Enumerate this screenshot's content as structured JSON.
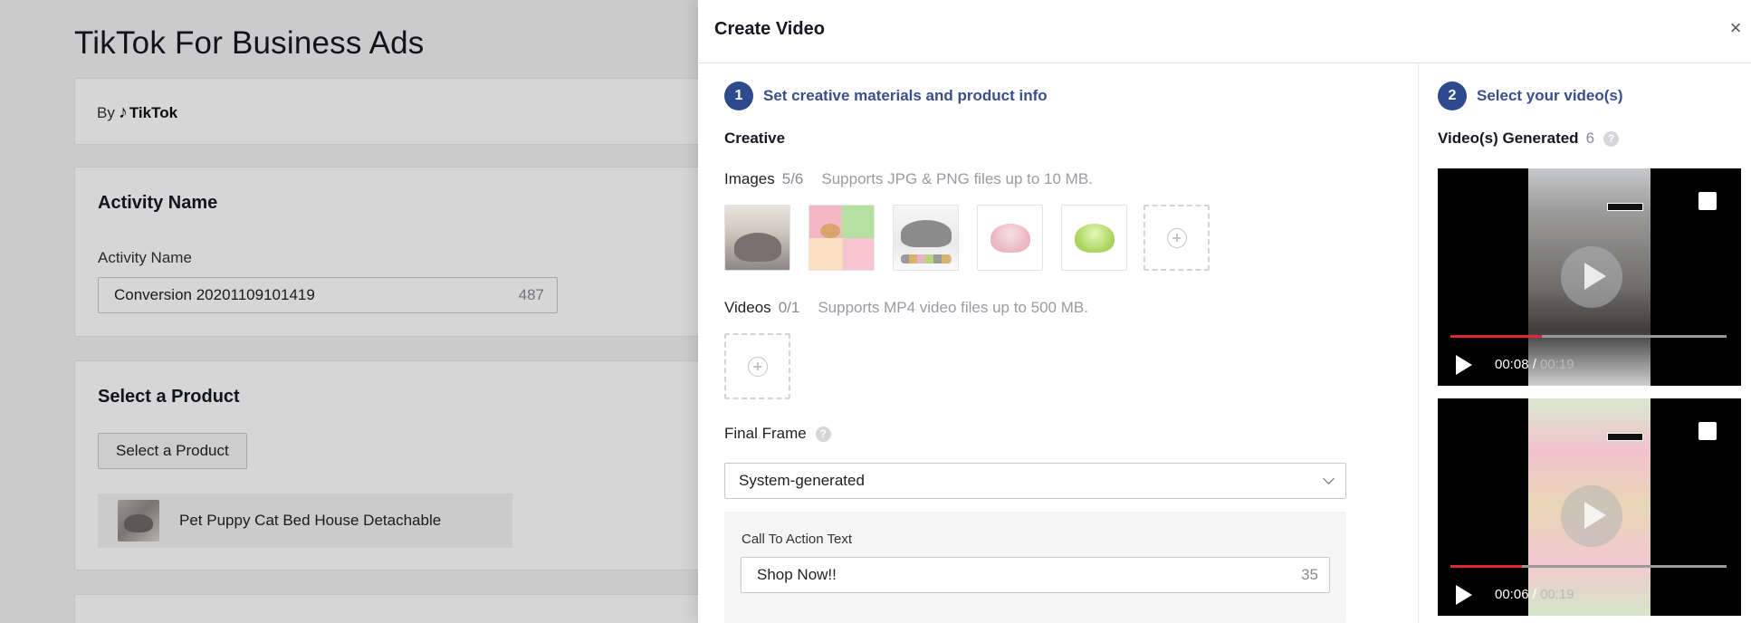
{
  "background_page": {
    "title": "TikTok For Business Ads",
    "by_label": "By",
    "tiktok_brand": "TikTok",
    "activity_card": {
      "heading": "Activity Name",
      "field_label": "Activity Name",
      "value": "Conversion 20201109101419",
      "char_count": "487"
    },
    "product_card": {
      "heading": "Select a Product",
      "button_label": "Select a Product",
      "selected_product": "Pet Puppy Cat Bed House Detachable"
    }
  },
  "modal": {
    "title": "Create Video",
    "close_glyph": "×",
    "step1": {
      "number": "1",
      "label": "Set creative materials and product info"
    },
    "step2": {
      "number": "2",
      "label": "Select your video(s)"
    },
    "creative": {
      "heading": "Creative",
      "images": {
        "label": "Images",
        "count": "5/6",
        "hint": "Supports JPG & PNG files up to 10 MB."
      },
      "videos": {
        "label": "Videos",
        "count": "0/1",
        "hint": "Supports MP4 video files up to 500 MB."
      }
    },
    "final_frame": {
      "label": "Final Frame",
      "help_glyph": "?",
      "selected": "System-generated"
    },
    "cta": {
      "label": "Call To Action Text",
      "value": "Shop Now!!",
      "char_count": "35"
    },
    "generated": {
      "label": "Video(s) Generated",
      "count": "6",
      "help_glyph": "?",
      "videos": [
        {
          "current": "00:08",
          "separator": " / ",
          "total": "00:19",
          "progress": 0.33
        },
        {
          "current": "00:06",
          "separator": " / ",
          "total": "00:19",
          "progress": 0.26
        }
      ]
    }
  },
  "colors": {
    "accent": "#2e4a8f",
    "accent_text": "#3a4f8c",
    "progress_red": "#e0262f"
  }
}
